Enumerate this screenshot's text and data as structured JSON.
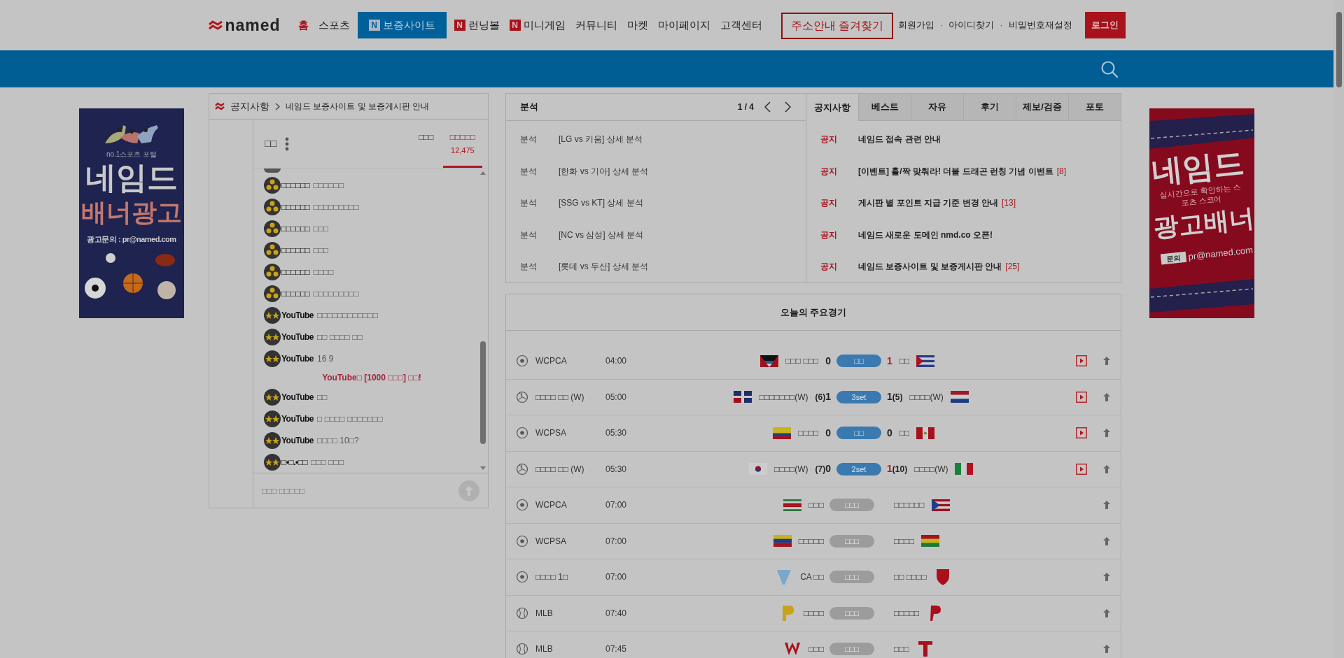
{
  "header": {
    "logo": "named",
    "nav": [
      {
        "label": "홈",
        "selected": true,
        "highlighted": false
      },
      {
        "label": "스포츠",
        "selected": false,
        "highlighted": false
      },
      {
        "label": "보증사이트",
        "badge": "N",
        "selected": false,
        "highlighted": true
      },
      {
        "label": "런닝볼",
        "badge": "N",
        "selected": false,
        "highlighted": false
      },
      {
        "label": "미니게임",
        "badge": "N",
        "selected": false,
        "highlighted": false
      },
      {
        "label": "커뮤니티",
        "selected": false,
        "highlighted": false
      },
      {
        "label": "마켓",
        "selected": false,
        "highlighted": false
      },
      {
        "label": "마이페이지",
        "selected": false,
        "highlighted": false
      },
      {
        "label": "고객센터",
        "selected": false,
        "highlighted": false
      }
    ],
    "bookmark_button": "주소안내 즐겨찾기",
    "account_links": [
      "회원가입",
      "아이디찾기",
      "비밀번호재설정"
    ],
    "separator": "·",
    "login_button": "로그인"
  },
  "left_banner": {
    "tagline": "no.1스포츠 포털",
    "title": "네임드",
    "subtitle": "배너광고",
    "contact": "광고문의 : pr@named.com"
  },
  "right_banner": {
    "title": "네임드",
    "tagline": "실시간으로 확인하는 스포츠 스코어",
    "subtitle": "광고배너",
    "contact_label": "문의",
    "contact": "pr@named.com"
  },
  "chat": {
    "breadcrumb": [
      "공지사항",
      "네임드 보증사이트 및 보증게시판 안내"
    ],
    "room": "□□",
    "tabs": [
      {
        "label": "□□□",
        "selected": false
      },
      {
        "label": "□□□□□",
        "count": "12,475",
        "selected": true
      }
    ],
    "messages": [
      {
        "kind": "gold",
        "name": "□□□□□□",
        "text": "□□□□□□"
      },
      {
        "kind": "gold",
        "name": "□□□□□□",
        "text": "□□□□□□□□□"
      },
      {
        "kind": "gold",
        "name": "□□□□□□",
        "text": "□□□"
      },
      {
        "kind": "gold",
        "name": "□□□□□□",
        "text": "□□□"
      },
      {
        "kind": "gold",
        "name": "□□□□□□",
        "text": "□□□□"
      },
      {
        "kind": "gold",
        "name": "□□□□□□",
        "text": "□□□□□□□□□"
      },
      {
        "kind": "stars",
        "name": "YouTube",
        "text": "□□□□□□□□□□□□"
      },
      {
        "kind": "stars",
        "name": "YouTube",
        "text": "□□ □□□□ □□"
      },
      {
        "kind": "stars",
        "name": "YouTube",
        "text": "16 9"
      },
      {
        "kind": "notice",
        "text": "YouTube□ [1000 □□□] □□!"
      },
      {
        "kind": "stars",
        "name": "YouTube",
        "text": "□□"
      },
      {
        "kind": "stars",
        "name": "YouTube",
        "text": "□ □□□□ □□□□□□□"
      },
      {
        "kind": "stars",
        "name": "YouTube",
        "text": "□□□□ 10□?"
      },
      {
        "kind": "stars",
        "name": "□•□.•□□",
        "text": "□□□ □□□"
      }
    ],
    "input": {
      "placeholder": "□□□ □□□□□"
    }
  },
  "analysis": {
    "title": "분석",
    "page": "1 / 4",
    "rows": [
      {
        "category": "분석",
        "title": "[LG vs 키움] 상세 분석"
      },
      {
        "category": "분석",
        "title": "[한화 vs 기아] 상세 분석"
      },
      {
        "category": "분석",
        "title": "[SSG vs KT] 상세 분석"
      },
      {
        "category": "분석",
        "title": "[NC vs 삼성] 상세 분석"
      },
      {
        "category": "분석",
        "title": "[롯데 vs 두산] 상세 분석"
      }
    ]
  },
  "board": {
    "tabs": [
      {
        "label": "공지사항",
        "selected": true
      },
      {
        "label": "베스트",
        "selected": false
      },
      {
        "label": "자유",
        "selected": false
      },
      {
        "label": "후기",
        "selected": false
      },
      {
        "label": "제보/검증",
        "selected": false
      },
      {
        "label": "포토",
        "selected": false
      }
    ],
    "rows": [
      {
        "tag": "공지",
        "title": "네임드 접속 관련 안내"
      },
      {
        "tag": "공지",
        "title": "[이벤트] 홀/짝 맞춰라! 더블 드래곤 런칭 기념 이벤트",
        "comments": "[8]"
      },
      {
        "tag": "공지",
        "title": "게시판 별 포인트 지급 기준 변경 안내",
        "comments": "[13]"
      },
      {
        "tag": "공지",
        "title": "네임드 새로운 도메인 nmd.co 오픈!"
      },
      {
        "tag": "공지",
        "title": "네임드 보증사이트 및 보증게시판 안내",
        "comments": "[25]"
      }
    ]
  },
  "games": {
    "title": "오늘의 주요경기",
    "rows": [
      {
        "kind": "soccer",
        "league": "WCPCA",
        "time": "04:00",
        "home": {
          "name": "□□□ □□□",
          "score": "0",
          "leading": false
        },
        "status": {
          "kind": "live",
          "text": "□□"
        },
        "away": {
          "name": "□□",
          "score": "1",
          "leading": true
        },
        "video": true
      },
      {
        "kind": "volleyball",
        "league": "□□□□ □□ (W)",
        "time": "05:00",
        "home": {
          "name": "□□□□□□□(W)",
          "points": "(6)",
          "score": "1",
          "leading": false
        },
        "status": {
          "kind": "live",
          "text": "3set"
        },
        "away": {
          "name": "□□□□(W)",
          "points": "(5)",
          "score": "1",
          "leading": false
        },
        "video": true
      },
      {
        "kind": "soccer",
        "league": "WCPSA",
        "time": "05:30",
        "home": {
          "name": "□□□□",
          "score": "0",
          "leading": false
        },
        "status": {
          "kind": "live",
          "text": "□□"
        },
        "away": {
          "name": "□□",
          "score": "0",
          "leading": false
        },
        "video": true
      },
      {
        "kind": "volleyball",
        "league": "□□□□ □□ (W)",
        "time": "05:30",
        "home": {
          "name": "□□□□(W)",
          "points": "(7)",
          "score": "0",
          "leading": false
        },
        "status": {
          "kind": "live",
          "text": "2set"
        },
        "away": {
          "name": "□□□□(W)",
          "points": "(10)",
          "score": "1",
          "leading": true
        },
        "video": true
      },
      {
        "kind": "soccer",
        "league": "WCPCA",
        "time": "07:00",
        "home": {
          "name": "□□□"
        },
        "status": {
          "kind": "scheduled",
          "text": "□□□"
        },
        "away": {
          "name": "□□□□□□"
        },
        "video": false
      },
      {
        "kind": "soccer",
        "league": "WCPSA",
        "time": "07:00",
        "home": {
          "name": "□□□□□"
        },
        "status": {
          "kind": "scheduled",
          "text": "□□□"
        },
        "away": {
          "name": "□□□□"
        },
        "video": false
      },
      {
        "kind": "soccer",
        "league": "□□□□ 1□",
        "time": "07:00",
        "home": {
          "name": "CA □□"
        },
        "status": {
          "kind": "scheduled",
          "text": "□□□"
        },
        "away": {
          "name": "□□ □□□□"
        },
        "video": false
      },
      {
        "kind": "baseball",
        "league": "MLB",
        "time": "07:40",
        "home": {
          "name": "□□□□"
        },
        "status": {
          "kind": "scheduled",
          "text": "□□□"
        },
        "away": {
          "name": "□□□□□"
        },
        "video": false
      },
      {
        "kind": "baseball",
        "league": "MLB",
        "time": "07:45",
        "home": {
          "name": "□□□"
        },
        "status": {
          "kind": "scheduled",
          "text": "□□□"
        },
        "away": {
          "name": "□□□"
        },
        "video": false
      }
    ]
  }
}
